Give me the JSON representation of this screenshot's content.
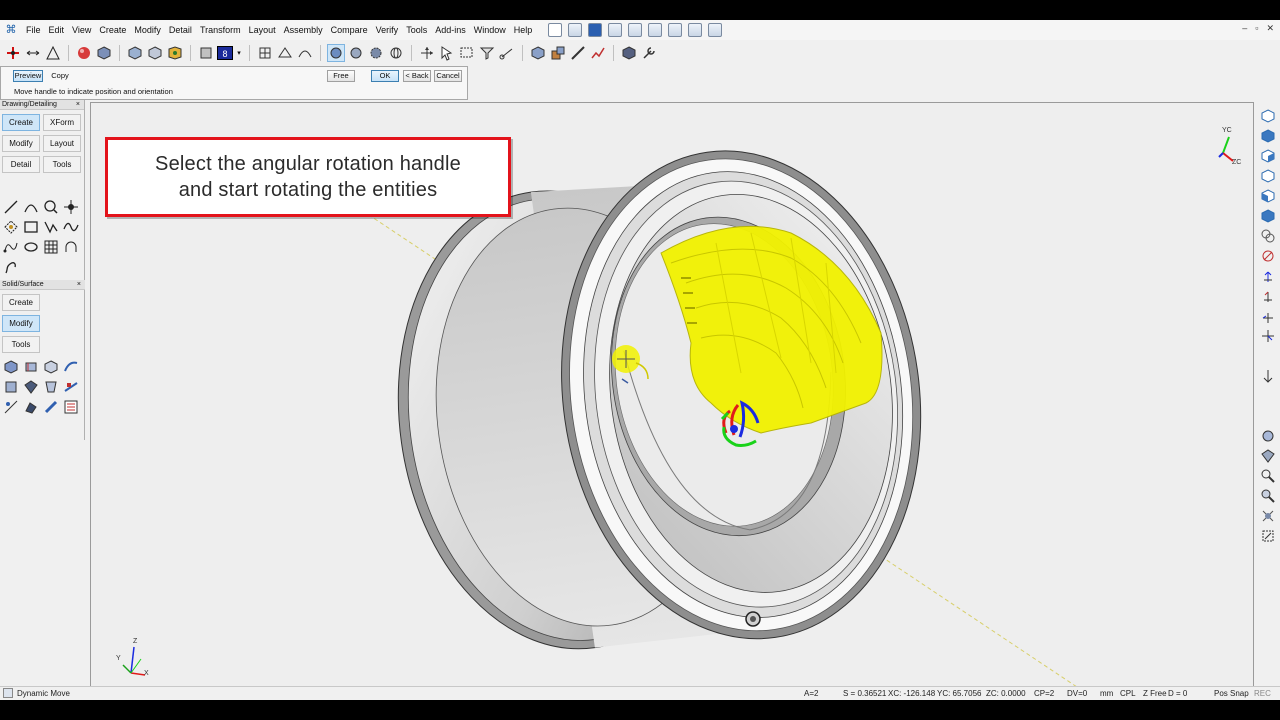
{
  "menu": [
    "File",
    "Edit",
    "View",
    "Create",
    "Modify",
    "Detail",
    "Transform",
    "Layout",
    "Assembly",
    "Compare",
    "Verify",
    "Tools",
    "Add-ins",
    "Window",
    "Help"
  ],
  "window_controls": [
    "‒",
    "▫",
    "✕"
  ],
  "toolbar": {
    "layer_value": "8"
  },
  "prompt": {
    "preview_label": "Preview",
    "copy_label": "Copy",
    "free_label": "Free",
    "ok_label": "OK",
    "back_label": "< Back",
    "cancel_label": "Cancel",
    "message": "Move handle to indicate position and orientation"
  },
  "drawing_panel": {
    "title": "Drawing/Detailing",
    "close": "×",
    "buttons": [
      "Create",
      "XForm",
      "Modify",
      "Layout",
      "Detail",
      "Tools"
    ],
    "selected": "Create"
  },
  "solid_panel": {
    "title": "Solid/Surface",
    "close": "×",
    "buttons": [
      "Create",
      "Modify",
      "Tools"
    ],
    "selected": "Modify"
  },
  "callout": {
    "line1": "Select the angular rotation handle",
    "line2": "and start rotating the entities"
  },
  "axes": {
    "world": {
      "x": "X",
      "y": "Y",
      "z": "Z"
    },
    "view": {
      "x": "XC",
      "y": "YC",
      "z": "ZC"
    }
  },
  "status": {
    "mode": "Dynamic Move",
    "attr": "A=2",
    "scale": "S = 0.36521",
    "xc": "XC: -126.148",
    "yc": "YC: 65.7056",
    "zc": "ZC: 0.0000",
    "cp": "CP=2",
    "dv": "DV=0",
    "units": "mm",
    "cpl": "CPL",
    "zfree": "Z Free",
    "d": "D = 0",
    "possnap": "Pos Snap",
    "rec": "REC"
  },
  "colors": {
    "callout_border": "#e3131b",
    "selection": "#f2f200",
    "handle_red": "#e01b1b",
    "handle_blue": "#1b2be0",
    "handle_green": "#19d219"
  }
}
